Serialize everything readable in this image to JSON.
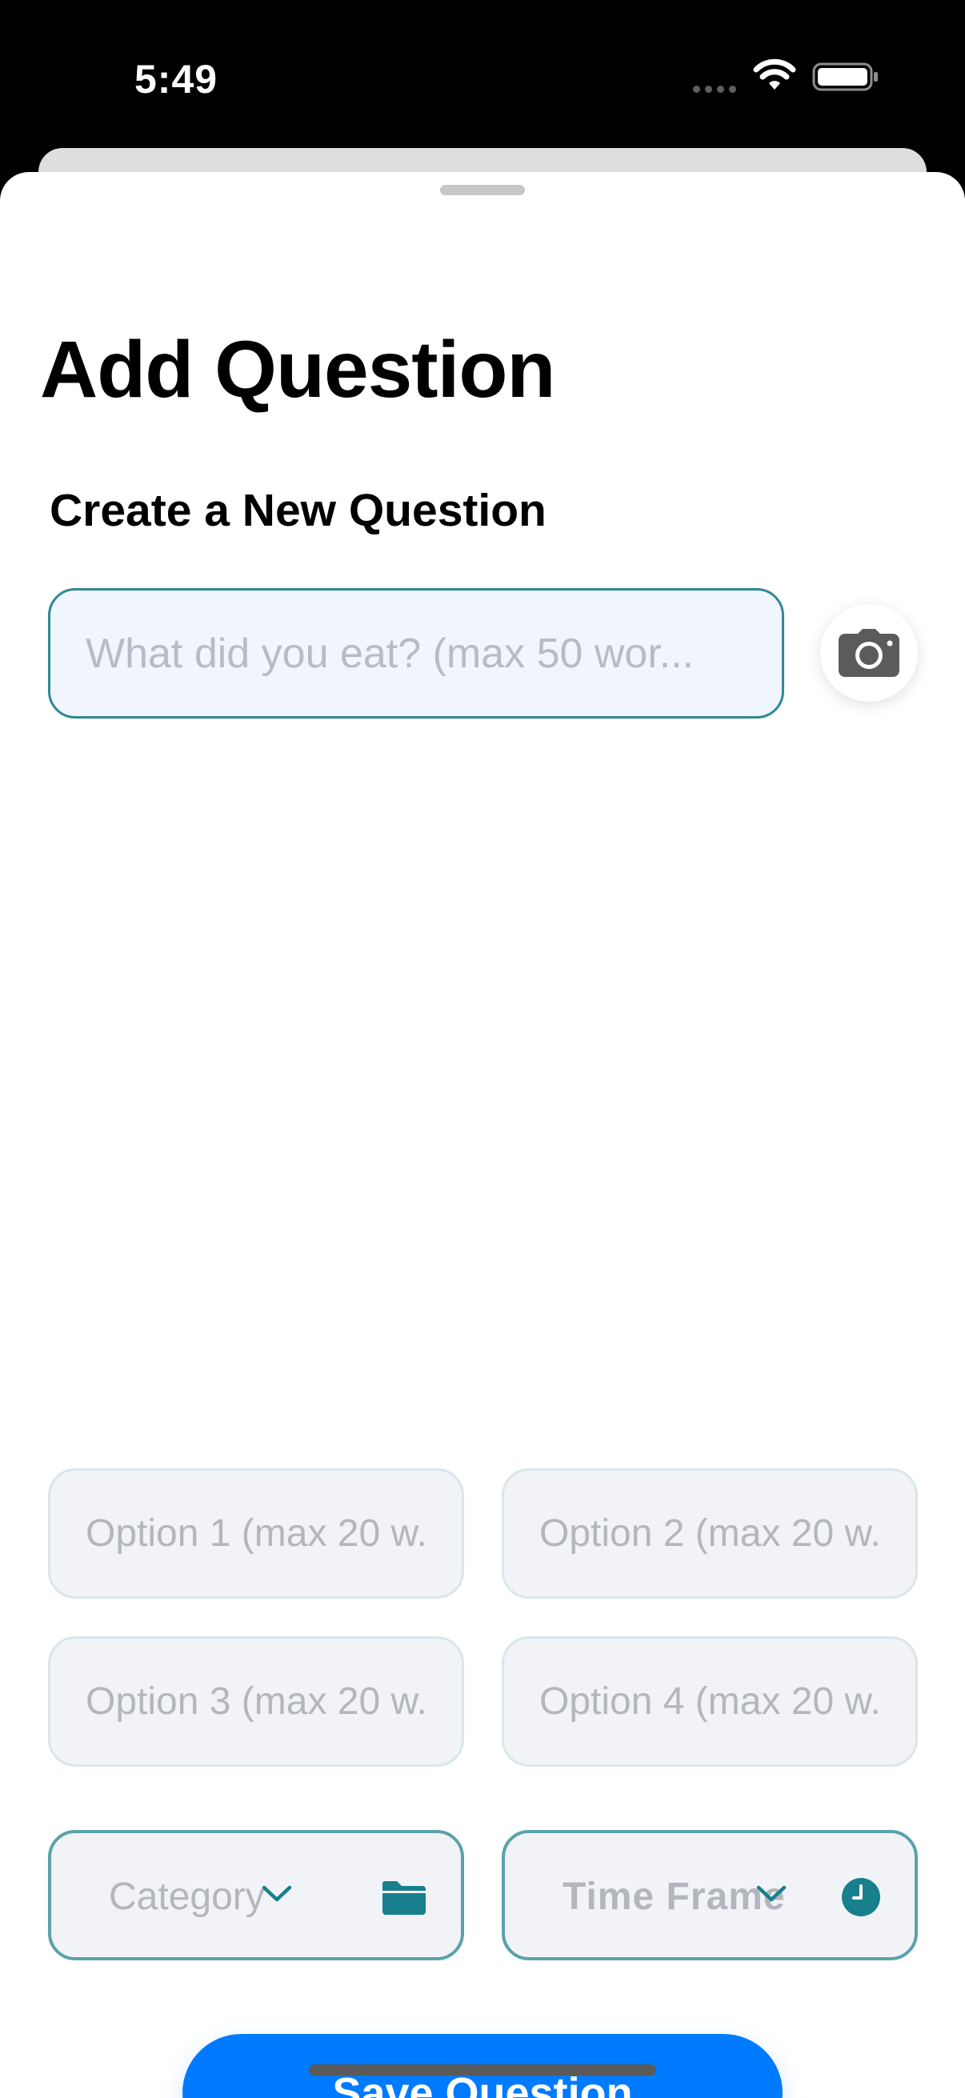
{
  "status_bar": {
    "time": "5:49"
  },
  "header": {
    "title": "Add Question",
    "subtitle": "Create a New Question"
  },
  "question": {
    "placeholder": "What did you eat? (max 50 wor...",
    "value": ""
  },
  "icons": {
    "camera": "camera-icon",
    "category": "folder-icon",
    "time_frame": "clock-icon",
    "chevron": "chevron-down-icon"
  },
  "options": [
    {
      "placeholder": "Option 1 (max 20 w..."
    },
    {
      "placeholder": "Option 2 (max 20 w..."
    },
    {
      "placeholder": "Option 3 (max 20 w..."
    },
    {
      "placeholder": "Option 4 (max 20 w..."
    }
  ],
  "pickers": {
    "category": {
      "label": "Category"
    },
    "time_frame": {
      "label": "Time Frame"
    }
  },
  "actions": {
    "save_label": "Save Question"
  },
  "colors": {
    "accent": "#007aff",
    "teal": "#17808c",
    "input_border": "#2f8a96",
    "input_bg": "#f1f5fd"
  }
}
